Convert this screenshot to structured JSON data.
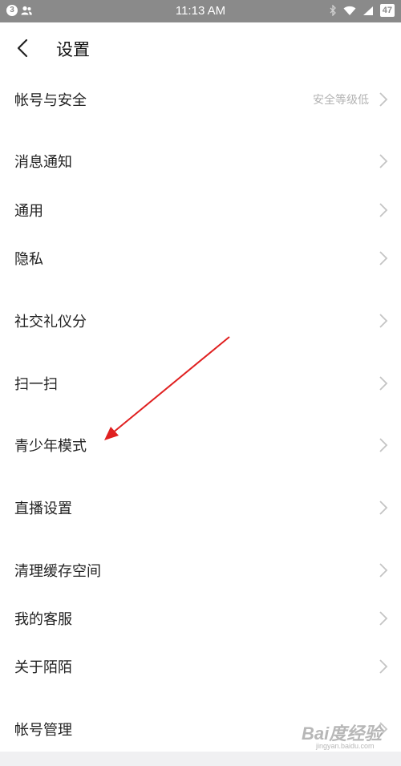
{
  "status_bar": {
    "notification_badge": "3",
    "time": "11:13 AM",
    "battery": "47"
  },
  "header": {
    "title": "设置"
  },
  "settings": [
    {
      "label": "帐号与安全",
      "value": "安全等级低"
    },
    {
      "label": "消息通知"
    },
    {
      "label": "通用"
    },
    {
      "label": "隐私"
    },
    {
      "label": "社交礼仪分"
    },
    {
      "label": "扫一扫"
    },
    {
      "label": "青少年模式"
    },
    {
      "label": "直播设置"
    },
    {
      "label": "清理缓存空间"
    },
    {
      "label": "我的客服"
    },
    {
      "label": "关于陌陌"
    },
    {
      "label": "帐号管理"
    }
  ],
  "watermark": {
    "brand": "Bai度经验",
    "url": "jingyan.baidu.com"
  },
  "colors": {
    "status_bar": "#8a8a8a",
    "arrow": "#e02020",
    "chevron": "#c4c4c4"
  }
}
